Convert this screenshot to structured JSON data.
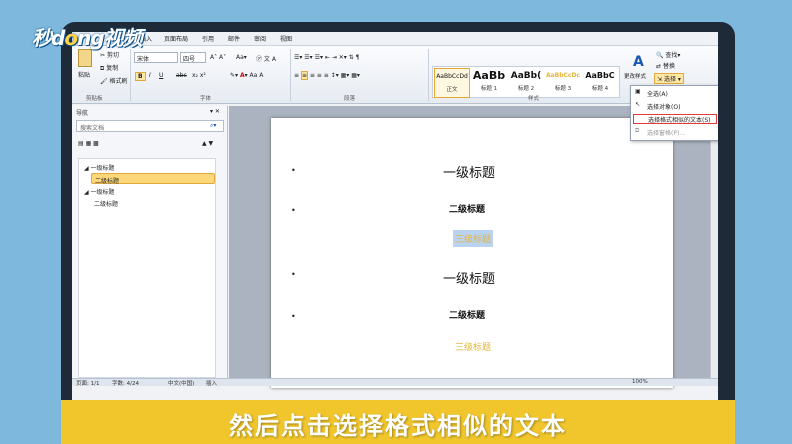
{
  "logo": {
    "pre": "秒d",
    "o": "o",
    "post": "ng视频"
  },
  "menu": [
    "插入",
    "页面布局",
    "引用",
    "邮件",
    "审阅",
    "视图"
  ],
  "clipboard": {
    "paste": "粘贴",
    "cut": "剪切",
    "copy": "复制",
    "format_painter": "格式刷",
    "group": "剪贴板"
  },
  "font": {
    "name": "宋体",
    "size": "四号",
    "group": "字体",
    "bold": "B",
    "italic": "I",
    "underline": "U",
    "strike": "abc"
  },
  "paragraph": {
    "group": "段落"
  },
  "styles": {
    "group": "样式",
    "items": [
      {
        "preview": "AaBbCcDd",
        "name": "正文"
      },
      {
        "preview": "AaBb",
        "name": "标题 1"
      },
      {
        "preview": "AaBb(",
        "name": "标题 2"
      },
      {
        "preview": "AaBbCcDc",
        "name": "标题 3"
      },
      {
        "preview": "AaBbC",
        "name": "标题 4"
      }
    ],
    "change": "更改样式"
  },
  "editing": {
    "find": "查找",
    "replace": "替换",
    "select": "选择"
  },
  "dropdown": {
    "select_all": "全选(A)",
    "select_objects": "选择对象(O)",
    "select_similar": "选择格式相似的文本(S)",
    "selection_pane": "选择窗格(P)..."
  },
  "nav": {
    "title": "导航",
    "search_placeholder": "搜索文档",
    "tree": [
      {
        "label": "一级标题",
        "level": 1
      },
      {
        "label": "二级标题",
        "level": 2,
        "selected": true
      },
      {
        "label": "一级标题",
        "level": 1
      },
      {
        "label": "二级标题",
        "level": 2
      }
    ]
  },
  "document": {
    "lines": [
      {
        "text": "一级标题",
        "level": 1
      },
      {
        "text": "二级标题",
        "level": 2
      },
      {
        "text": "三级标题",
        "level": 3,
        "highlight": true
      },
      {
        "text": "一级标题",
        "level": 1
      },
      {
        "text": "二级标题",
        "level": 2
      },
      {
        "text": "三级标题",
        "level": 3
      }
    ]
  },
  "status": {
    "page": "页面: 1/1",
    "words": "字数: 4/24",
    "lang": "中文(中国)",
    "mode": "插入",
    "zoom": "100%"
  },
  "caption": "然后点击选择格式相似的文本",
  "colors": {
    "accent_yellow": "#f1c62c",
    "frame": "#1e2a38",
    "heading3": "#e5b53c",
    "selection": "#fcd77a"
  }
}
